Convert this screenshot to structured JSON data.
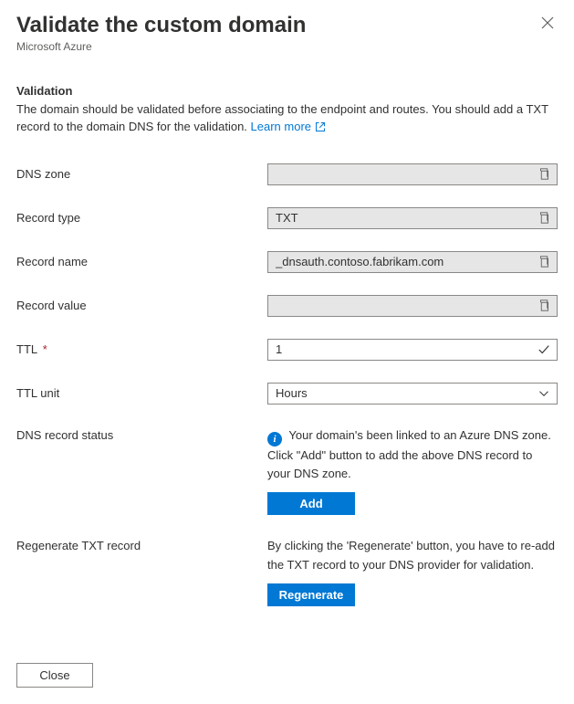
{
  "header": {
    "title": "Validate the custom domain",
    "subtitle": "Microsoft Azure"
  },
  "validation": {
    "section_title": "Validation",
    "description_a": "The domain should be validated before associating to the endpoint and routes. You should add a TXT record to the domain DNS for the validation. ",
    "learn_more": "Learn more"
  },
  "fields": {
    "dns_zone": {
      "label": "DNS zone",
      "value": ""
    },
    "record_type": {
      "label": "Record type",
      "value": "TXT"
    },
    "record_name": {
      "label": "Record name",
      "value": "_dnsauth.contoso.fabrikam.com"
    },
    "record_value": {
      "label": "Record value",
      "value": ""
    },
    "ttl": {
      "label": "TTL",
      "value": "1"
    },
    "ttl_unit": {
      "label": "TTL unit",
      "value": "Hours"
    }
  },
  "status": {
    "label": "DNS record status",
    "text": "Your domain's been linked to an Azure DNS zone. Click \"Add\" button to add the above DNS record to your DNS zone.",
    "add_button": "Add"
  },
  "regenerate": {
    "label": "Regenerate TXT record",
    "text": "By clicking the 'Regenerate' button, you have to re-add the TXT record to your DNS provider for validation.",
    "button": "Regenerate"
  },
  "footer": {
    "close": "Close"
  }
}
